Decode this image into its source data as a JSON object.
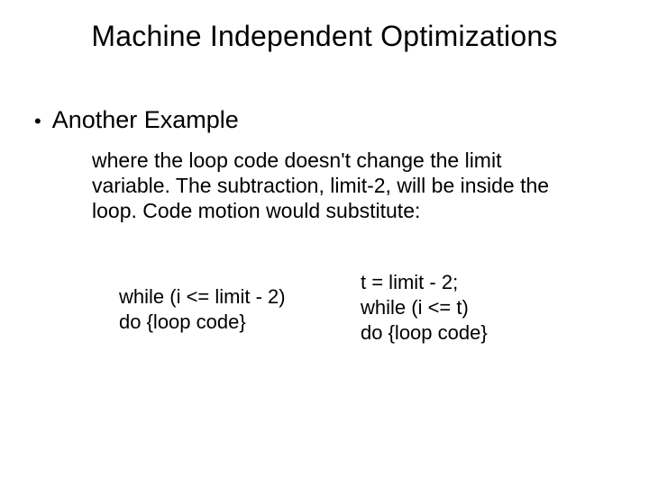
{
  "title": "Machine Independent Optimizations",
  "bullet": {
    "marker": "•",
    "text": "Another Example"
  },
  "paragraph": "where the loop code doesn't change the limit variable. The subtraction, limit-2, will be inside the loop. Code motion would substitute:",
  "code": {
    "left": {
      "line1": "while (i <= limit - 2)",
      "line2": "do {loop code}"
    },
    "right": {
      "line1": "t = limit - 2;",
      "line2": "while (i <= t)",
      "line3": "do {loop code}"
    }
  }
}
